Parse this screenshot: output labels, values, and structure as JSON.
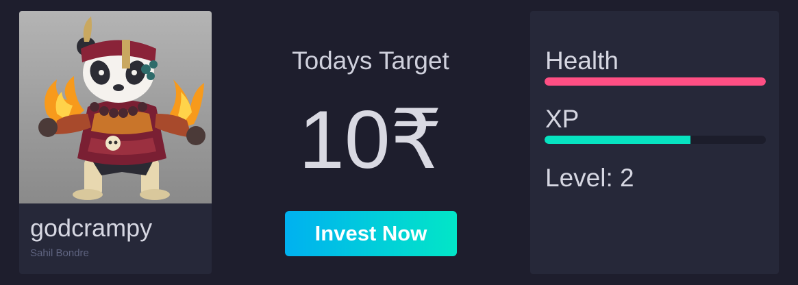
{
  "profile": {
    "username": "godcrampy",
    "real_name": "Sahil Bondre",
    "avatar_alt": "panda warrior avatar"
  },
  "target": {
    "title": "Todays Target",
    "amount": "10₹",
    "button_label": "Invest Now"
  },
  "stats": {
    "health": {
      "label": "Health",
      "fraction": 1.0,
      "color": "#fe4f84"
    },
    "xp": {
      "label": "XP",
      "fraction": 0.66,
      "color": "#07e3c1"
    },
    "level_text": "Level: 2"
  },
  "colors": {
    "background": "#1e1e2d",
    "card": "#262839",
    "button_gradient_start": "#00b1f0",
    "button_gradient_end": "#02e6c7"
  }
}
